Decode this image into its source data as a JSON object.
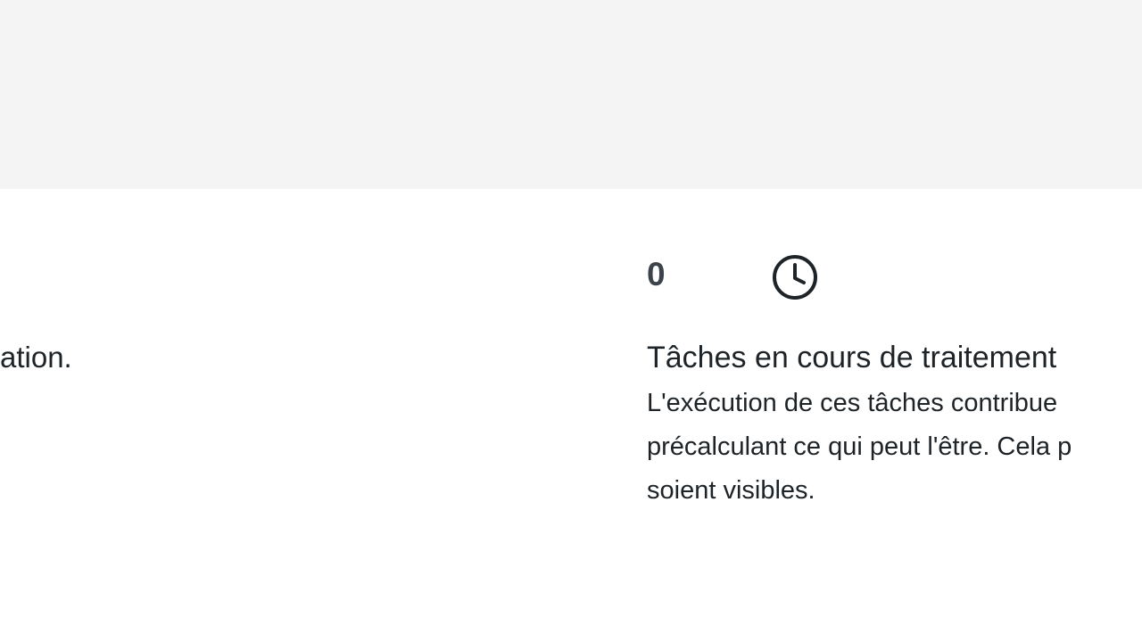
{
  "left_panel": {
    "text_fragment": "ation."
  },
  "task_card": {
    "count": "0",
    "icon": "clock-icon",
    "title": "Tâches en cours de traitement",
    "description_lines": [
      "L'exécution de ces tâches contribue",
      "précalculant ce qui peut l'être. Cela p",
      "soient visibles."
    ]
  },
  "colors": {
    "top_band": "#f4f4f4",
    "text": "#1d2327",
    "count_text": "#3c434a"
  }
}
